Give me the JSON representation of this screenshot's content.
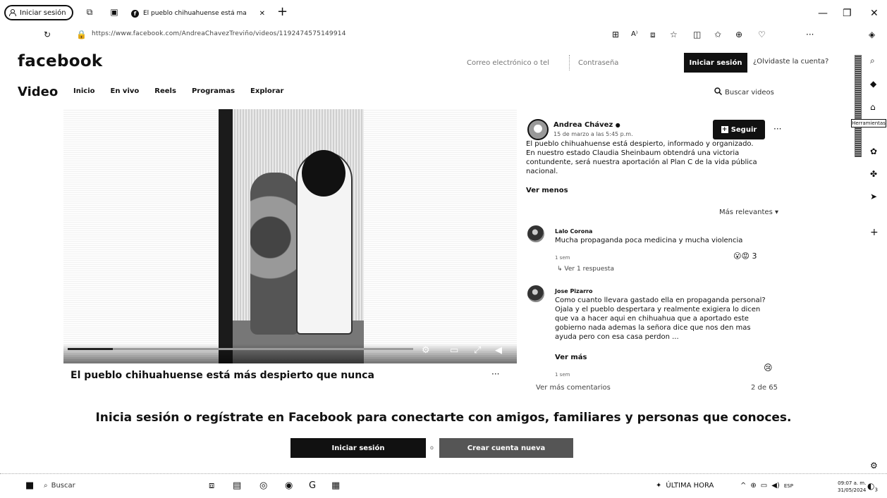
{
  "browser": {
    "profile_label": "Iniciar sesión",
    "tab_title": "El pueblo chihuahuense está ma",
    "url": "https://www.facebook.com/AndreaChavezTreviño/videos/1192474575149914",
    "tooltip": "Herramientas"
  },
  "header": {
    "logo": "facebook",
    "email_placeholder": "Correo electrónico o tel",
    "password_placeholder": "Contraseña",
    "login_button": "Iniciar sesión",
    "forgot_link": "¿Olvidaste la cuenta?"
  },
  "video_nav": {
    "title": "Video",
    "items": [
      "Inicio",
      "En vivo",
      "Reels",
      "Programas",
      "Explorar"
    ],
    "search_placeholder": "Buscar videos"
  },
  "player": {
    "progress": 0.13,
    "post_title": "El pueblo chihuahuense está más despierto que nunca",
    "more": "···"
  },
  "post": {
    "author": "Andrea Chávez",
    "date": "15 de marzo a las 5:45 p.m.",
    "follow_label": "Seguir",
    "more": "···",
    "text_1": "El pueblo chihuahuense está despierto, informado y organizado.",
    "text_2": "En nuestro estado Claudia Sheinbaum obtendrá una victoria contundente, será nuestra aportación al Plan C de la vida pública nacional.",
    "see_less": "Ver menos",
    "sort": "Más relevantes"
  },
  "comments": [
    {
      "name": "Lalo Corona",
      "text": "Mucha propaganda poca medicina y mucha violencia",
      "time": "1 sem",
      "reactions": "3",
      "reply_link": "Ver 1 respuesta"
    },
    {
      "name": "Jose Pizarro",
      "text": "Como cuanto llevara gastado ella en propaganda personal? Ojala y el pueblo despertara y realmente exigiera lo dicen que va a hacer aqui en chihuahua que a aportado este gobierno nada ademas la señora dice que nos den mas ayuda pero con esa casa perdon ...",
      "see_more": "Ver más",
      "time": "1 sem"
    }
  ],
  "comments_footer": {
    "more": "Ver más comentarios",
    "count": "2 de 65"
  },
  "cta": {
    "text": "Inicia sesión o regístrate en Facebook para conectarte con amigos, familiares y personas que conoces.",
    "login": "Iniciar sesión",
    "or": "o",
    "create": "Crear cuenta nueva"
  },
  "taskbar": {
    "search": "Buscar",
    "news": "ÚLTIMA HORA",
    "lang": "ESP",
    "time": "09:07 a. m.",
    "date": "31/05/2024",
    "notif_count": "3"
  }
}
